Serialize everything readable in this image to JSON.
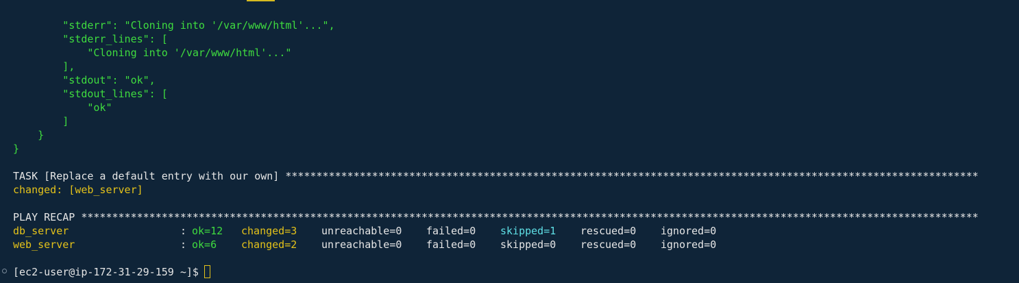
{
  "terminal": {
    "json_output": [
      "        \"stderr\": \"Cloning into '/var/www/html'...\",",
      "        \"stderr_lines\": [",
      "            \"Cloning into '/var/www/html'...\"",
      "        ],",
      "        \"stdout\": \"ok\",",
      "        \"stdout_lines\": [",
      "            \"ok\"",
      "        ]",
      "    }",
      "}"
    ],
    "task_header": "TASK [Replace a default entry with our own] ****************************************************************************************************************",
    "task_result": "changed: [web_server]",
    "recap_header": "PLAY RECAP *************************************************************************************************************************************************",
    "recap_rows": [
      {
        "host": "db_server",
        "sep": ":",
        "ok": "ok=12",
        "changed": "changed=3",
        "unreachable": "unreachable=0",
        "failed": "failed=0",
        "skipped": "skipped=1",
        "rescued": "rescued=0",
        "ignored": "ignored=0"
      },
      {
        "host": "web_server",
        "sep": ":",
        "ok": "ok=6",
        "changed": "changed=2",
        "unreachable": "unreachable=0",
        "failed": "failed=0",
        "skipped": "skipped=0",
        "rescued": "rescued=0",
        "ignored": "ignored=0"
      }
    ],
    "prompt": "[ec2-user@ip-172-31-29-159 ~]$",
    "colors": {
      "background": "#0f2438",
      "green": "#3fdc3f",
      "yellow": "#e4c21a",
      "cyan": "#5fe0e6",
      "text": "#e6e6e6"
    }
  }
}
